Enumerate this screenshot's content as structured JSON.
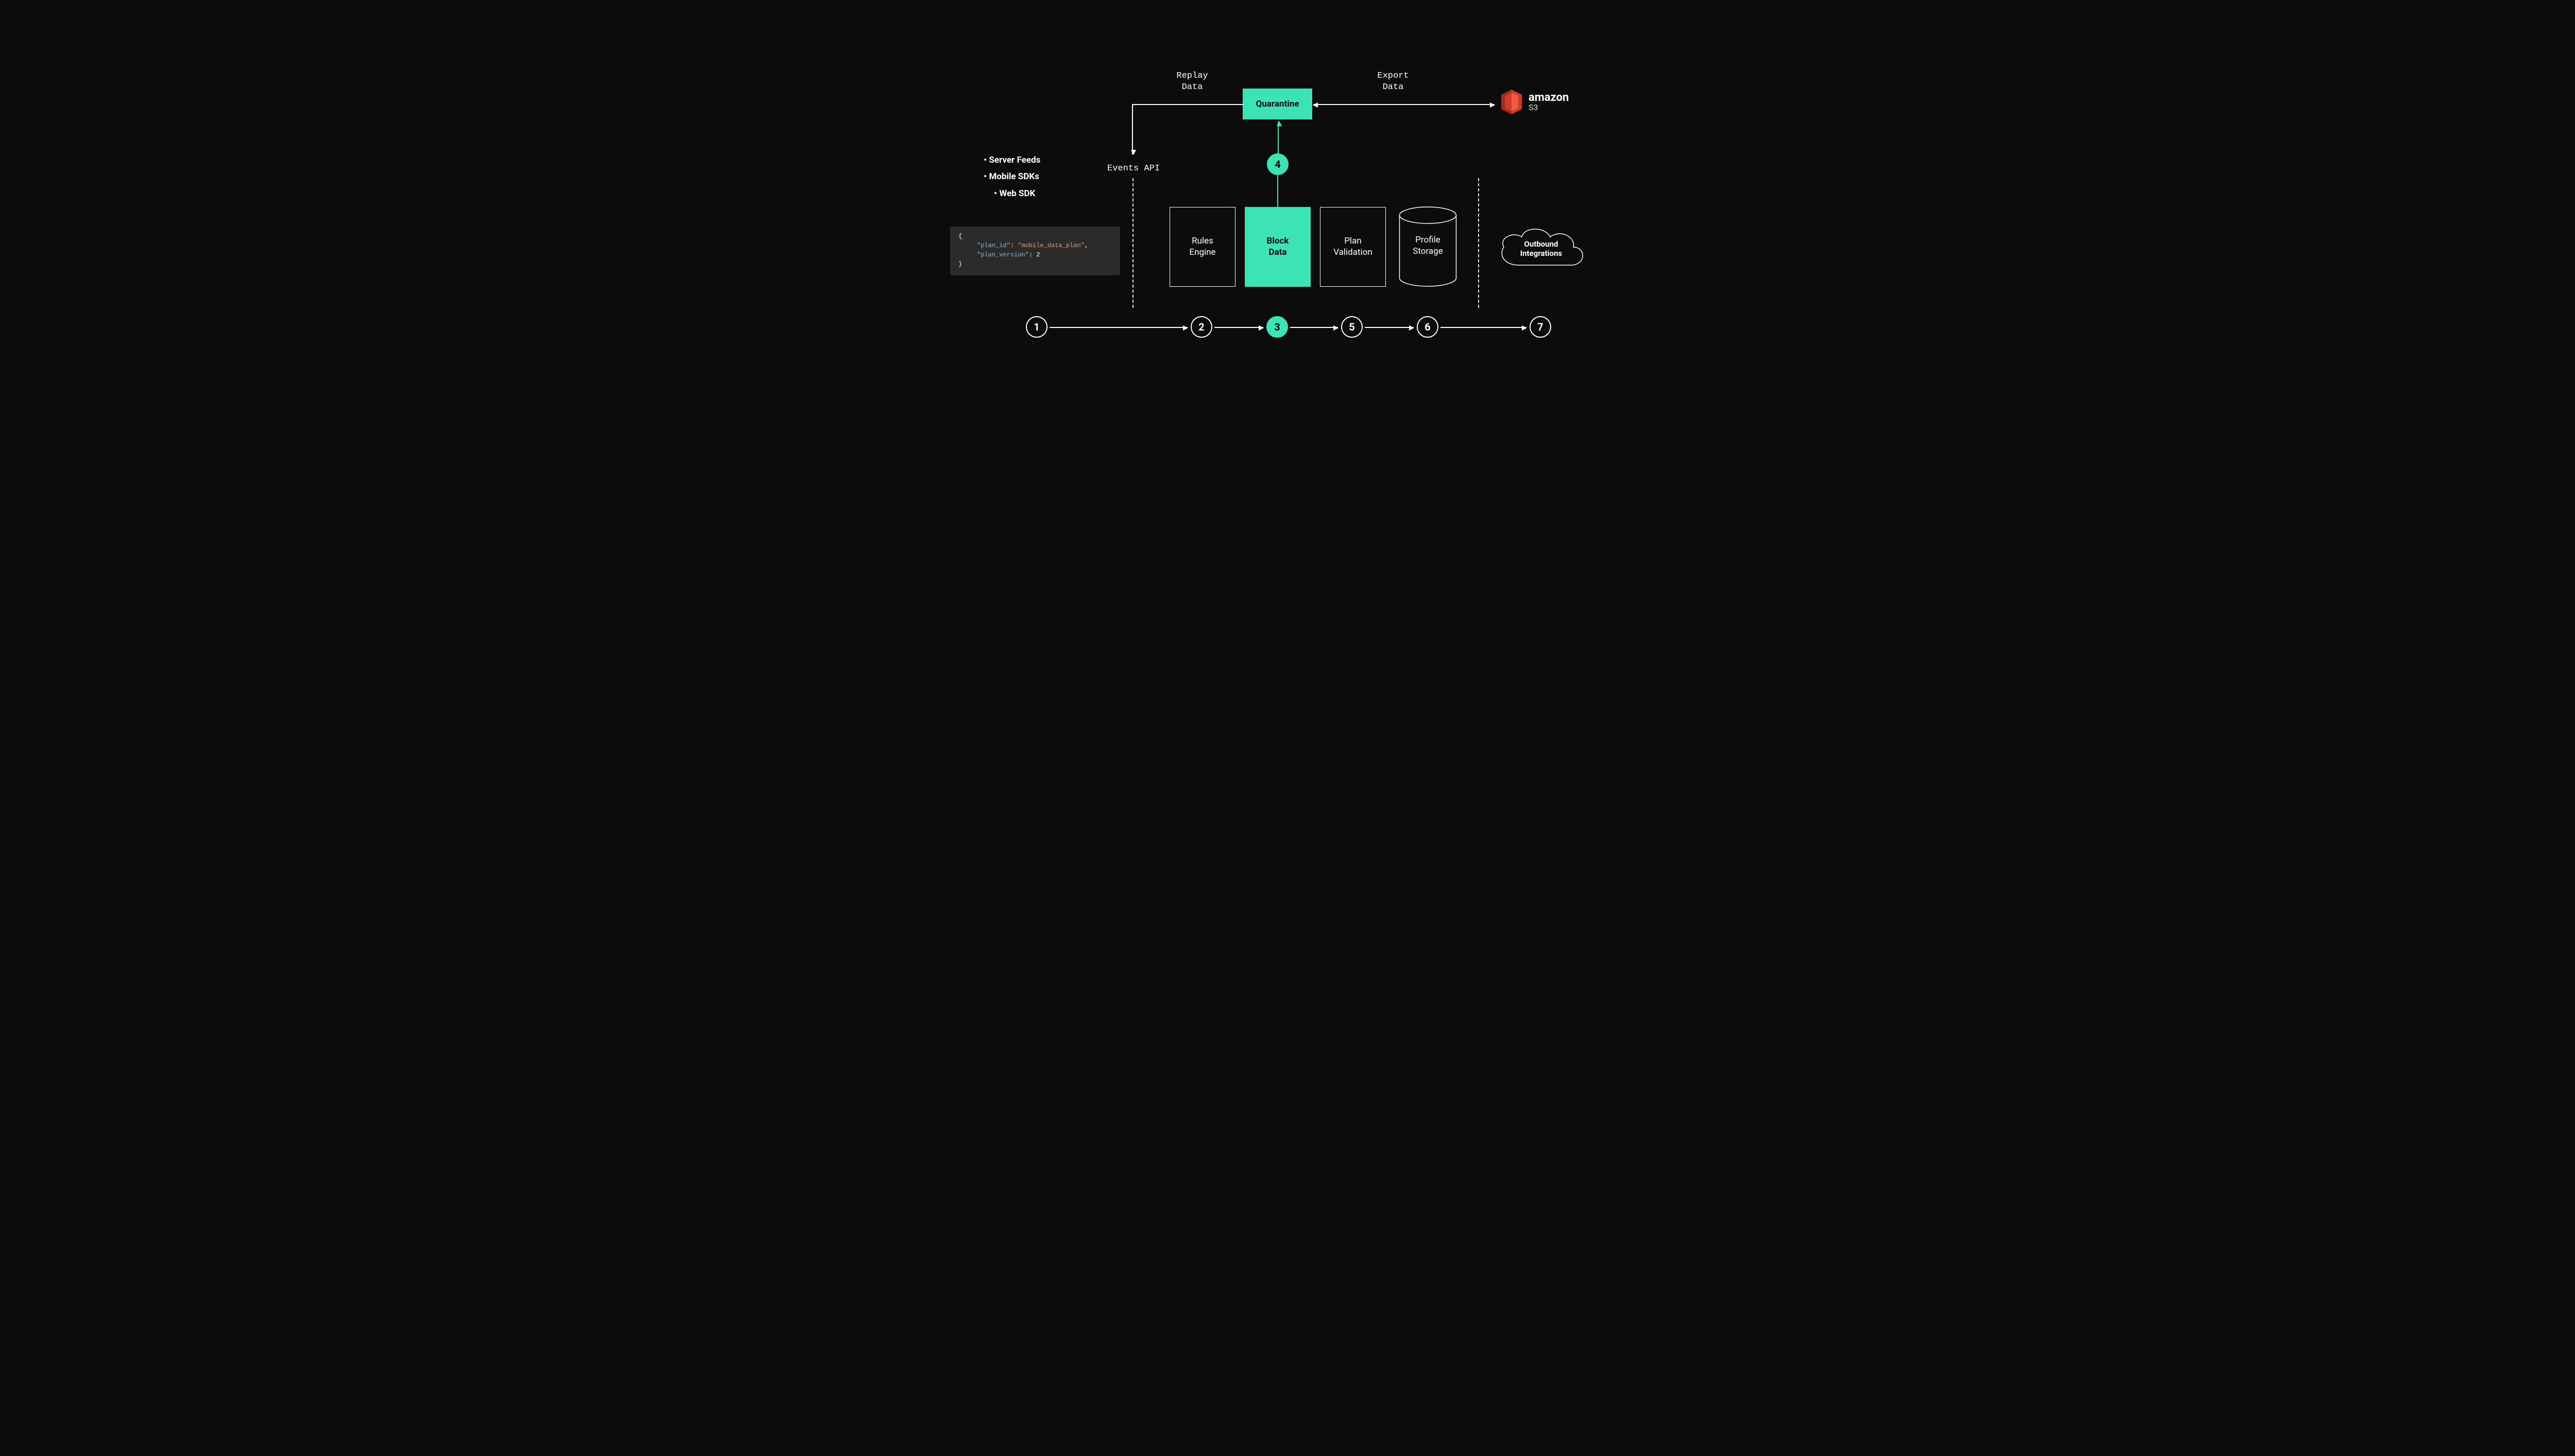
{
  "sources": {
    "items": [
      "Server Feeds",
      "Mobile SDKs",
      "Web SDK"
    ]
  },
  "code": {
    "open": "{",
    "k1": "\"plan_id\"",
    "v1": "\"mobile_data_plan\"",
    "k2": "\"plan_version\"",
    "v2n": "2",
    "close": "}"
  },
  "labels": {
    "events_api": "Events API",
    "replay_line1": "Replay",
    "replay_line2": "Data",
    "export_line1": "Export",
    "export_line2": "Data",
    "quarantine": "Quarantine"
  },
  "pipeline": {
    "rules_line1": "Rules",
    "rules_line2": "Engine",
    "block_line1": "Block",
    "block_line2": "Data",
    "plan_line1": "Plan",
    "plan_line2": "Validation",
    "profile_line1": "Profile",
    "profile_line2": "Storage",
    "outbound_line1": "Outbound",
    "outbound_line2": "Integrations"
  },
  "steps": {
    "s1": "1",
    "s2": "2",
    "s3": "3",
    "s4": "4",
    "s5": "5",
    "s6": "6",
    "s7": "7"
  },
  "s3": {
    "brand": "amazon",
    "service": "S3"
  }
}
